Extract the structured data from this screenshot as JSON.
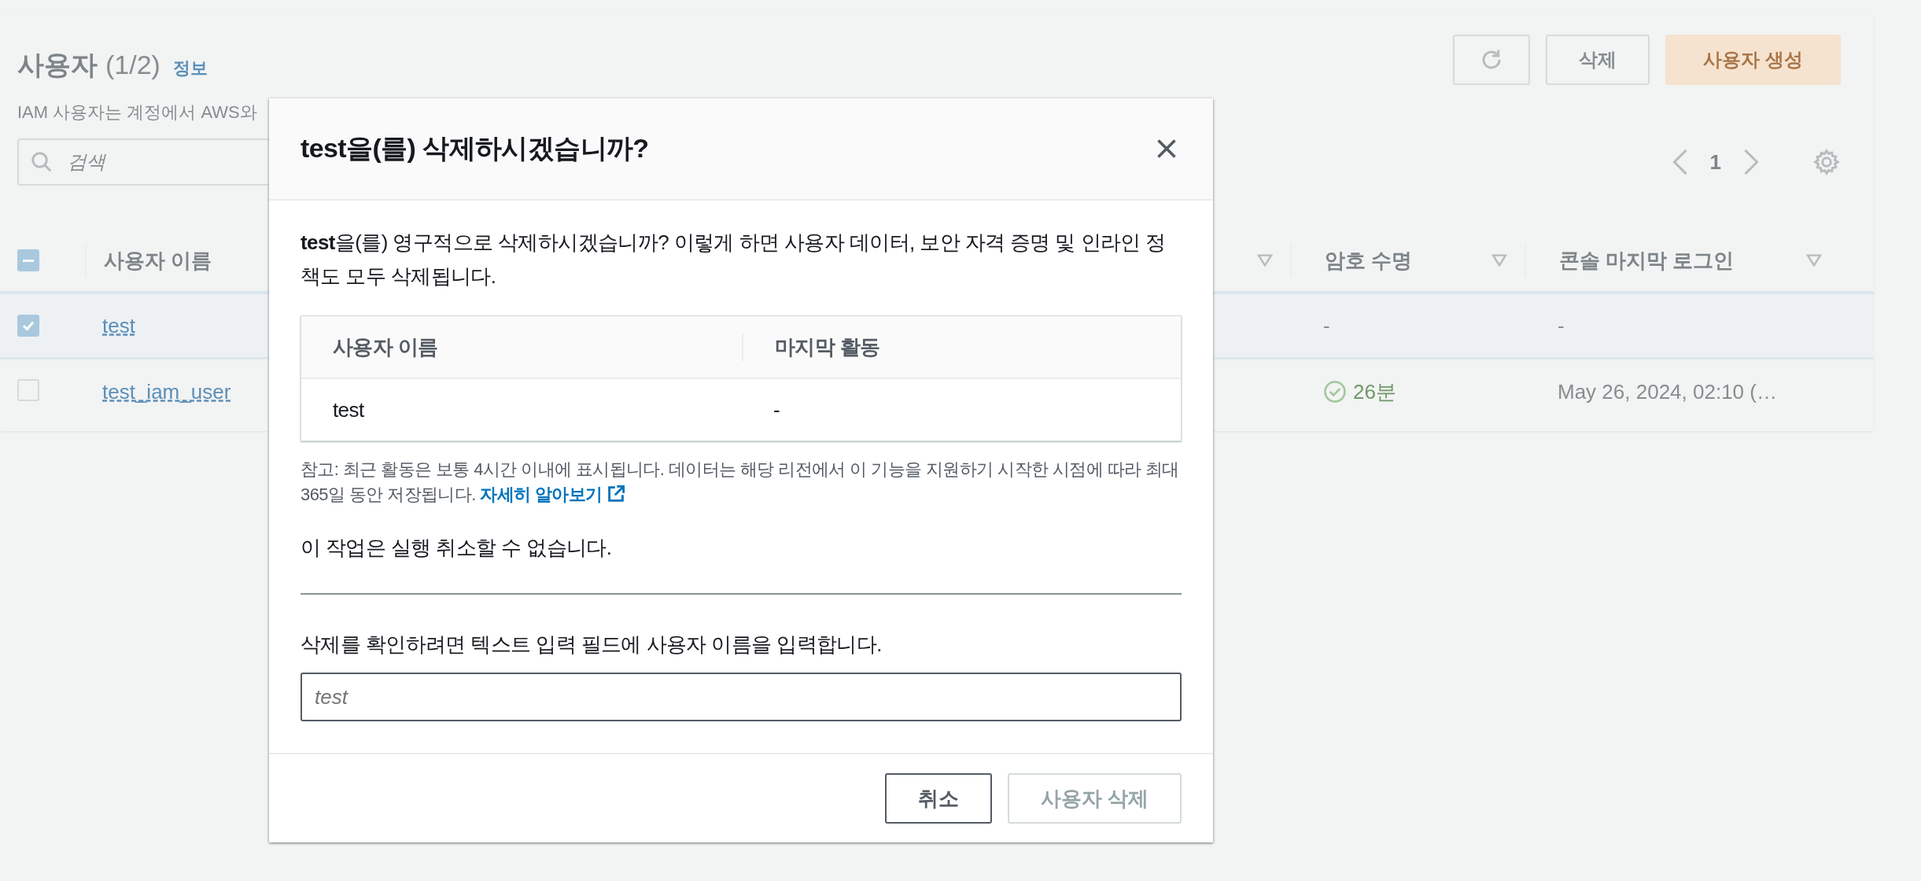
{
  "page": {
    "title": "사용자",
    "count": "(1/2)",
    "info_link": "정보",
    "description": "IAM 사용자는 계정에서 AWS와",
    "buttons": [
      {
        "kind": "refresh"
      },
      {
        "kind": "normal",
        "label": "삭제"
      },
      {
        "kind": "primary",
        "label": "사용자 생성"
      }
    ],
    "search": {
      "placeholder": "검색"
    },
    "pagination": {
      "page": "1"
    },
    "table": {
      "select_all": {
        "indeterminate": true
      },
      "columns": [
        {
          "label": "사용자 이름",
          "sortable": false
        },
        {
          "sortable": true
        },
        {
          "label": "암호 수명",
          "sortable": true
        },
        {
          "label": "콘솔 마지막 로그인",
          "sortable": true
        }
      ],
      "rows": [
        {
          "selected": true,
          "name": "test",
          "password_age": {
            "text": "-",
            "ok": false
          },
          "console_login": "-"
        },
        {
          "selected": false,
          "name": "test_iam_user",
          "password_age": {
            "text": "26분",
            "ok": true
          },
          "console_login": "May 26, 2024, 02:10 (…"
        }
      ]
    }
  },
  "dialog": {
    "title": "test을(를) 삭제하시겠습니까?",
    "message": "**test**을(를) 영구적으로 삭제하시겠습니까? 이렇게 하면 사용자 데이터, 보안 자격 증명 및 인라인 정책도 모두 삭제됩니다.",
    "table": {
      "columns": [
        "사용자 이름",
        "마지막 활동"
      ],
      "rows": [
        [
          "test",
          "-"
        ]
      ]
    },
    "note": "참고: 최근 활동은 보통 4시간 이내에 표시됩니다. 데이터는 해당 리전에서 이 기능을 지원하기 시작한 시점에 따라 최대 365일 동안 저장됩니다.",
    "note_link": "자세히 알아보기",
    "warning": "이 작업은 실행 취소할 수 없습니다.",
    "confirm_label": "삭제를 확인하려면 텍스트 입력 필드에 사용자 이름을 입력합니다.",
    "confirm_input": {
      "placeholder": "test"
    },
    "buttons": [
      {
        "kind": "cancel",
        "label": "취소",
        "disabled": false
      },
      {
        "kind": "danger",
        "label": "사용자 삭제",
        "disabled": true
      }
    ]
  }
}
